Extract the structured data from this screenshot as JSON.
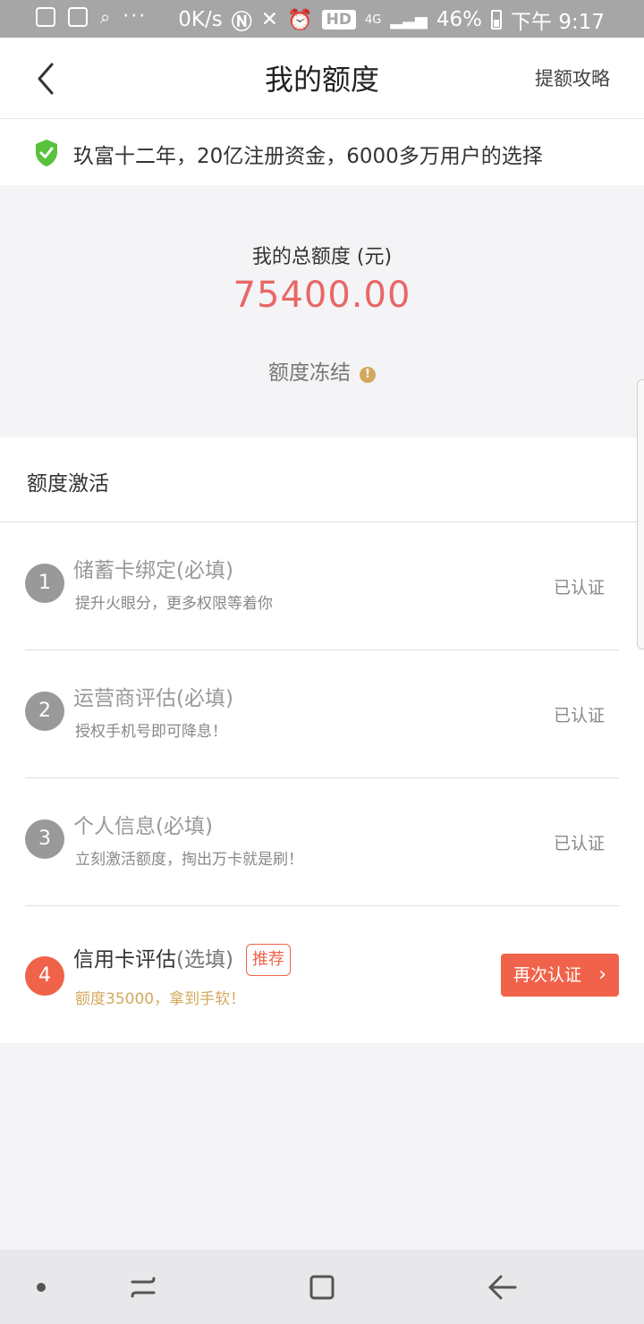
{
  "status_bar": {
    "net_speed": "0K/s",
    "hd": "HD",
    "network": "4G",
    "battery": "46%",
    "time": "下午 9:17"
  },
  "header": {
    "title": "我的额度",
    "right_link": "提额攻略"
  },
  "banner": {
    "text": "玖富十二年，20亿注册资金，6000多万用户的选择"
  },
  "quota": {
    "label": "我的总额度 (元)",
    "amount": "75400.00",
    "status": "额度冻结",
    "info_glyph": "!"
  },
  "activation": {
    "title": "额度激活",
    "steps": [
      {
        "num": "1",
        "title": "储蓄卡绑定(必填)",
        "subtitle": "提升火眼分，更多权限等着你",
        "status": "已认证"
      },
      {
        "num": "2",
        "title": "运营商评估(必填)",
        "subtitle": "授权手机号即可降息！",
        "status": "已认证"
      },
      {
        "num": "3",
        "title": "个人信息(必填)",
        "subtitle": "立刻激活额度，掏出万卡就是刷！",
        "status": "已认证"
      },
      {
        "num": "4",
        "title_main": "信用卡评估",
        "title_opt": "(选填)",
        "badge": "推荐",
        "subtitle": "额度35000，拿到手软！",
        "button": "再次认证",
        "button_chevron": "›"
      }
    ]
  },
  "colors": {
    "accent": "#f0634a",
    "amount": "#e86767",
    "gold": "#d4a85e",
    "shield": "#58c23c"
  }
}
